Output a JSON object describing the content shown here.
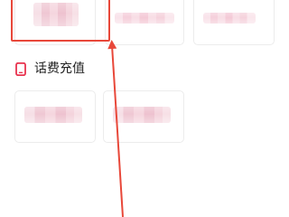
{
  "recharge_section": {
    "title": "话费充值",
    "icon": "phone-icon",
    "icon_color": "#e8334f"
  },
  "annotation": {
    "highlight_color": "#e8483a",
    "arrow_color": "#e8483a"
  }
}
